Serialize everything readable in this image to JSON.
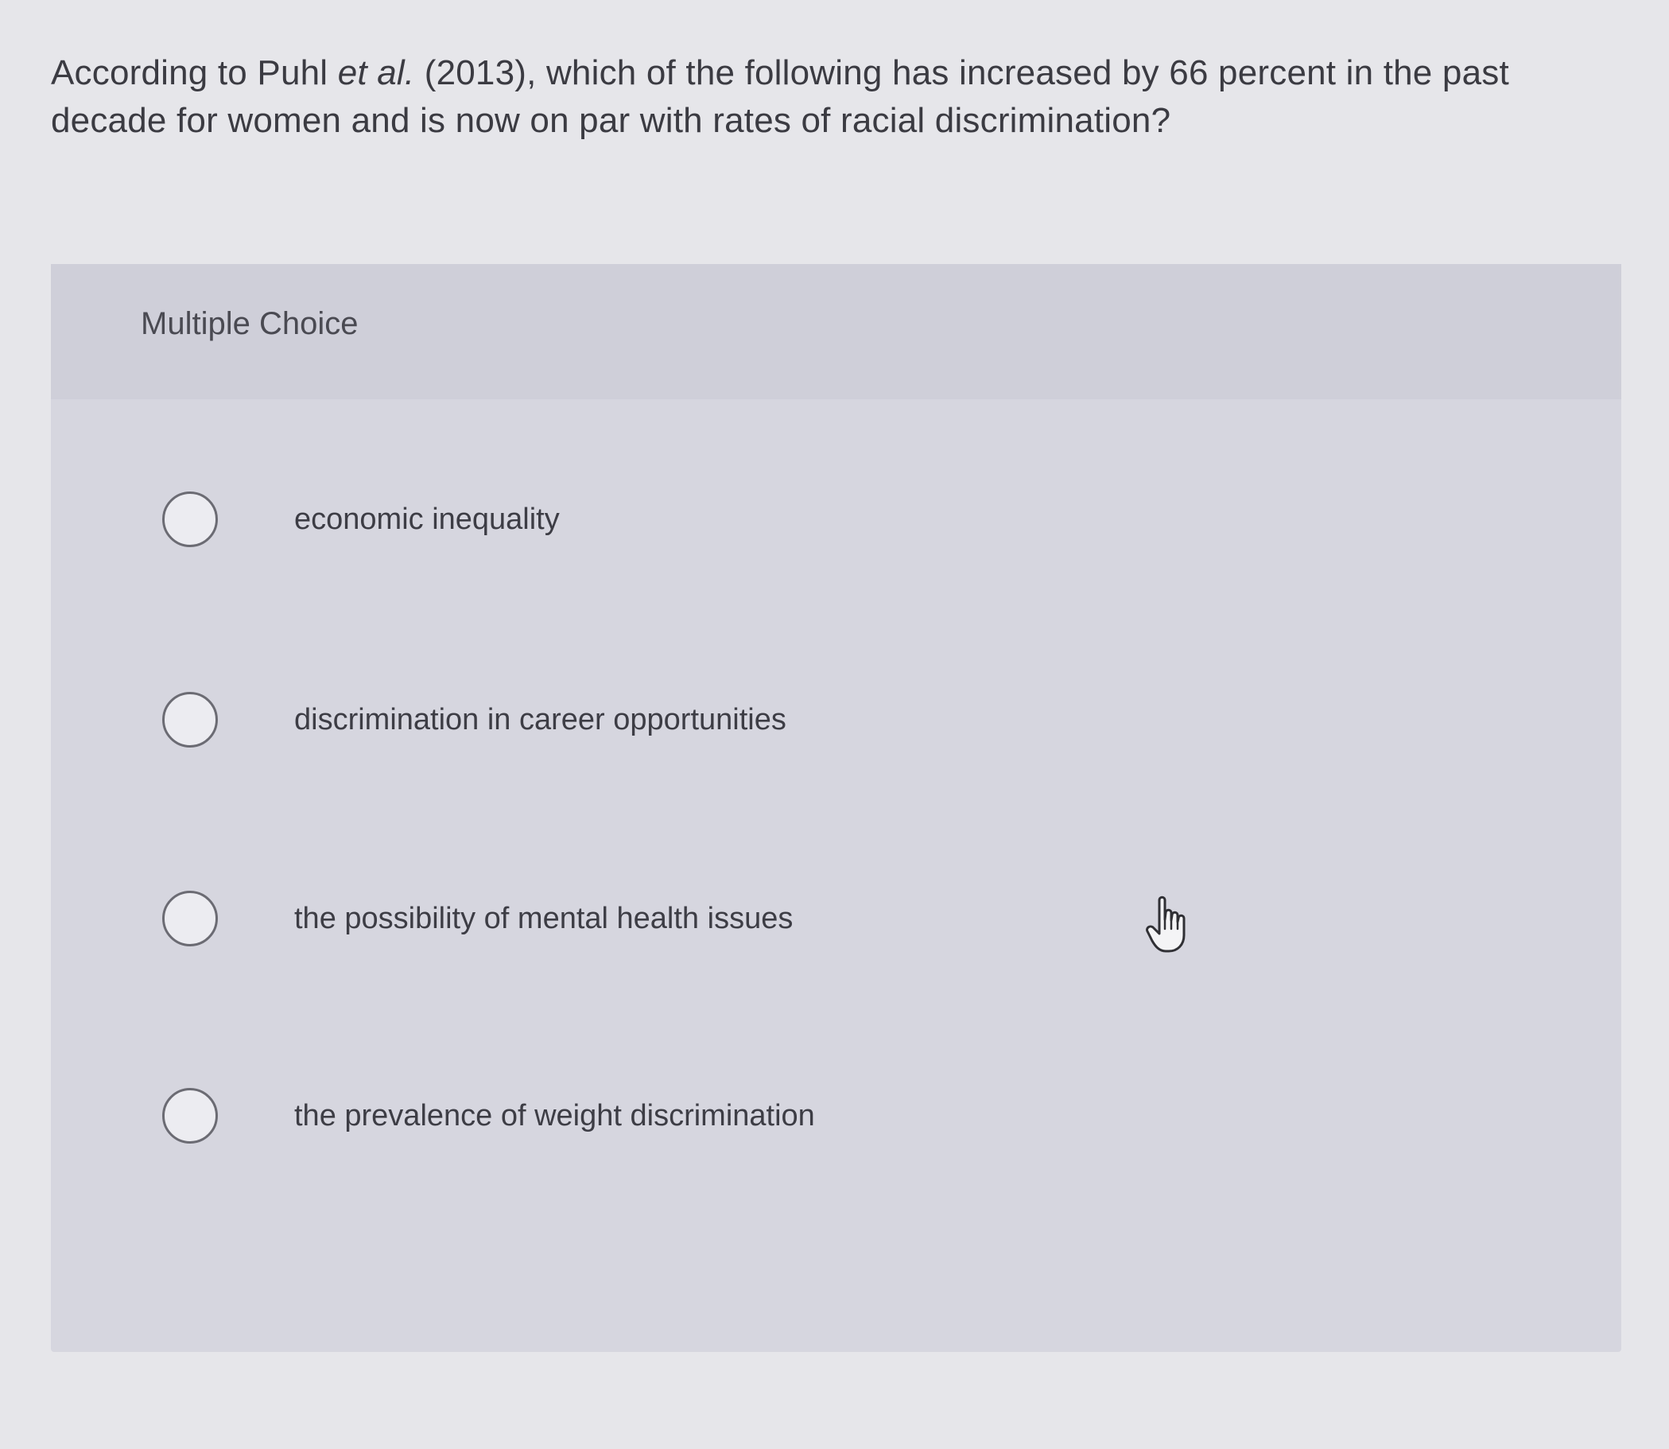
{
  "question": {
    "text_before": "According to Puhl ",
    "text_italic": "et al.",
    "text_after": " (2013), which of the following has increased by 66 percent in the past decade for women and is now on par with rates of racial discrimination?"
  },
  "card": {
    "title": "Multiple Choice",
    "options": [
      {
        "label": "economic inequality",
        "selected": false
      },
      {
        "label": "discrimination in career opportunities",
        "selected": false
      },
      {
        "label": "the possibility of mental health issues",
        "selected": false
      },
      {
        "label": "the prevalence of weight discrimination",
        "selected": false
      }
    ]
  },
  "icons": {
    "cursor": "hand-pointer-icon"
  },
  "colors": {
    "page_background": "#e6e6ea",
    "card_background": "#d6d6df",
    "text": "#3d3d45"
  }
}
